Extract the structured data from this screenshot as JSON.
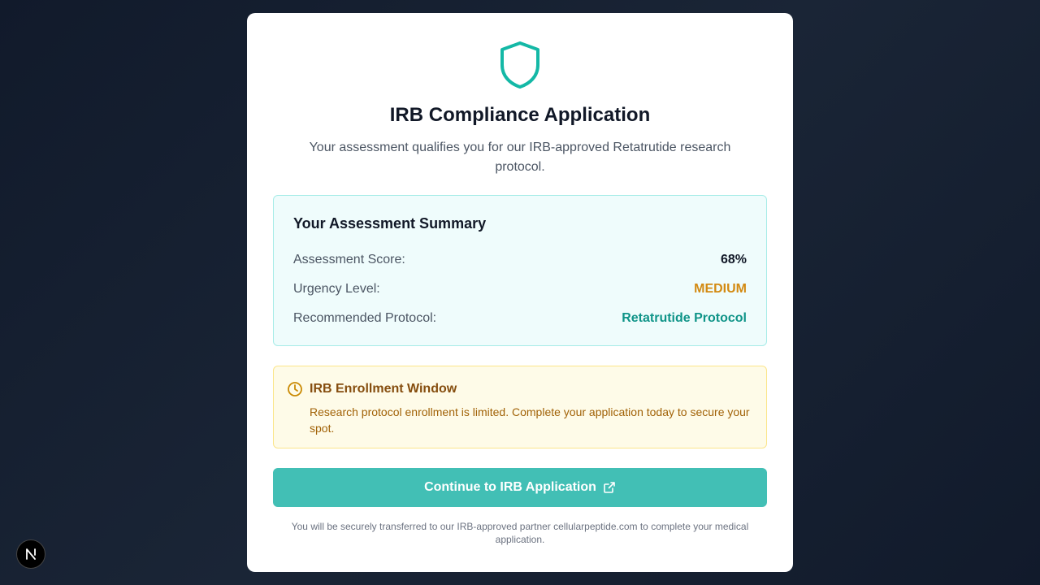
{
  "header": {
    "icon": "shield-icon",
    "title": "IRB Compliance Application",
    "subtitle": "Your assessment qualifies you for our IRB-approved Retatrutide research protocol."
  },
  "summary": {
    "title": "Your Assessment Summary",
    "rows": [
      {
        "label": "Assessment Score:",
        "value": "68%"
      },
      {
        "label": "Urgency Level:",
        "value": "MEDIUM"
      },
      {
        "label": "Recommended Protocol:",
        "value": "Retatrutide Protocol"
      }
    ]
  },
  "notice": {
    "icon": "clock-icon",
    "title": "IRB Enrollment Window",
    "text": "Research protocol enrollment is limited. Complete your application today to secure your spot."
  },
  "cta": {
    "label": "Continue to IRB Application",
    "icon": "external-link-icon"
  },
  "footnote": "You will be securely transferred to our IRB-approved partner cellularpeptide.com to complete your medical application.",
  "colors": {
    "accent": "#42bfb5",
    "urgency": "#d38a12",
    "protocol": "#0f9488"
  }
}
